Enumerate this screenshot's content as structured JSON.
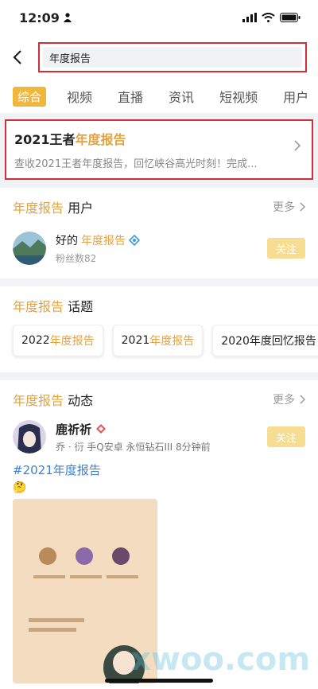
{
  "status": {
    "time": "12:09"
  },
  "search": {
    "query": "年度报告"
  },
  "tabs": [
    "综合",
    "视频",
    "直播",
    "资讯",
    "短视频",
    "用户"
  ],
  "report": {
    "title_prefix": "2021王者",
    "title_highlight": "年度报告",
    "desc": "查收2021王者年度报告，回忆峡谷高光时刻！完成..."
  },
  "users_section": {
    "kw": "年度报告",
    "title": "用户",
    "more": "更多",
    "user": {
      "name_prefix": "好的",
      "name_highlight": "年度报告",
      "fans": "粉丝数82",
      "follow": "关注"
    }
  },
  "topics_section": {
    "kw": "年度报告",
    "title": "话题",
    "chips": [
      {
        "prefix": "2022",
        "highlight": "年度报告",
        "suffix": ""
      },
      {
        "prefix": "2021",
        "highlight": "年度报告",
        "suffix": ""
      },
      {
        "prefix": "2020年度回忆报告",
        "highlight": "",
        "suffix": ""
      }
    ]
  },
  "posts_section": {
    "kw": "年度报告",
    "title": "动态",
    "more": "更多",
    "post": {
      "name": "鹿祈祈",
      "meta": "乔 · 衍  手Q安卓  永恒钻石III  8分钟前",
      "follow": "关注",
      "hashtag": "#2021年度报告",
      "emoji": "🤔"
    }
  },
  "watermark": "xwoo.com",
  "colors": {
    "accent": "#f0b73a",
    "highlight": "#e6a23c",
    "box": "#d12e3a",
    "link": "#3e7fd6"
  }
}
